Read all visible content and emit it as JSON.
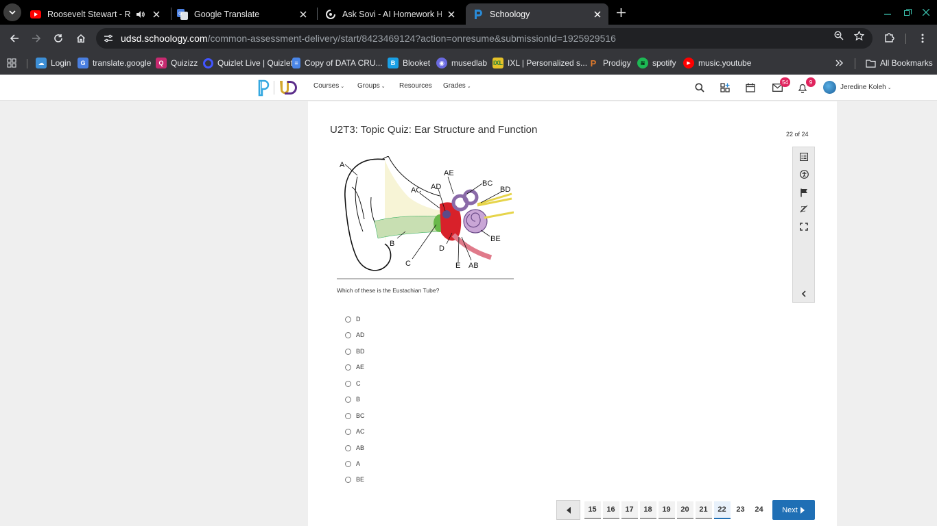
{
  "browser": {
    "tabs": [
      {
        "title": "Roosevelt Stewart - Redeem",
        "favicon": "youtube-icon",
        "audio": true
      },
      {
        "title": "Google Translate",
        "favicon": "google-translate-icon"
      },
      {
        "title": "Ask Sovi - AI Homework Helper",
        "favicon": "sovi-icon"
      },
      {
        "title": "Schoology",
        "favicon": "schoology-icon",
        "active": true
      }
    ],
    "url_host": "udsd.schoology.com",
    "url_path": "/common-assessment-delivery/start/8423469124?action=onresume&submissionId=1925929516",
    "bookmarks": [
      {
        "label": "Login",
        "color": "#3d8fd6"
      },
      {
        "label": "translate.google",
        "color": "#4a7fe0"
      },
      {
        "label": "Quizizz",
        "color": "#c72a70"
      },
      {
        "label": "Quizlet Live | Quizlet",
        "color": "#4255ff"
      },
      {
        "label": "Copy of DATA CRU...",
        "color": "#4a86e8"
      },
      {
        "label": "Blooket",
        "color": "#1aa0e6"
      },
      {
        "label": "musedlab",
        "color": "#6a6ae0"
      },
      {
        "label": "IXL | Personalized s...",
        "color": "#e6c229"
      },
      {
        "label": "Prodigy",
        "color": "#e07a2c"
      },
      {
        "label": "spotify",
        "color": "#1db954"
      },
      {
        "label": "music.youtube",
        "color": "#ff0000"
      }
    ],
    "all_bookmarks_label": "All Bookmarks"
  },
  "schoology": {
    "nav": [
      "Courses",
      "Groups",
      "Resources",
      "Grades"
    ],
    "mail_count": "54",
    "notif_count": "9",
    "user_name": "Jeredine Koleh"
  },
  "quiz": {
    "title": "U2T3: Topic Quiz: Ear Structure and Function",
    "progress": "22 of 24",
    "question": "Which of these is the Eustachian Tube?",
    "diagram_labels": [
      "A",
      "AE",
      "BC",
      "BD",
      "AC",
      "AD",
      "B",
      "BE",
      "D",
      "C",
      "E",
      "AB"
    ],
    "choices": [
      "D",
      "AD",
      "BD",
      "AE",
      "C",
      "B",
      "BC",
      "AC",
      "AB",
      "A",
      "BE"
    ],
    "pages": [
      "15",
      "16",
      "17",
      "18",
      "19",
      "20",
      "21",
      "22",
      "23",
      "24"
    ],
    "current_page": "22",
    "next_label": "Next"
  }
}
